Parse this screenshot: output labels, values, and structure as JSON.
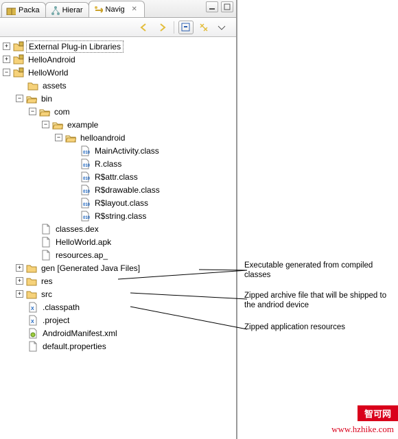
{
  "tabs": {
    "packa": "Packa",
    "hierar": "Hierar",
    "navig": "Navig"
  },
  "tree": {
    "ext_plugin": "External Plug-in Libraries",
    "hello_android": "HelloAndroid",
    "hello_world": "HelloWorld",
    "assets": "assets",
    "bin": "bin",
    "com": "com",
    "example": "example",
    "helloandroid_pkg": "helloandroid",
    "main_activity": "MainActivity.class",
    "r_class": "R.class",
    "r_attr": "R$attr.class",
    "r_drawable": "R$drawable.class",
    "r_layout": "R$layout.class",
    "r_string": "R$string.class",
    "classes_dex": "classes.dex",
    "helloworld_apk": "HelloWorld.apk",
    "resources_ap": "resources.ap_",
    "gen": "gen [Generated Java Files]",
    "res": "res",
    "src": "src",
    "classpath": ".classpath",
    "project": ".project",
    "manifest": "AndroidManifest.xml",
    "default_props": "default.properties"
  },
  "annotations": {
    "classes_dex": "Executable generated from compiled classes",
    "apk": "Zipped archive file that will be shipped to the andriod device",
    "resources": "Zipped application resources"
  },
  "watermark": {
    "badge": "智可网",
    "url": "www.hzhike.com"
  }
}
